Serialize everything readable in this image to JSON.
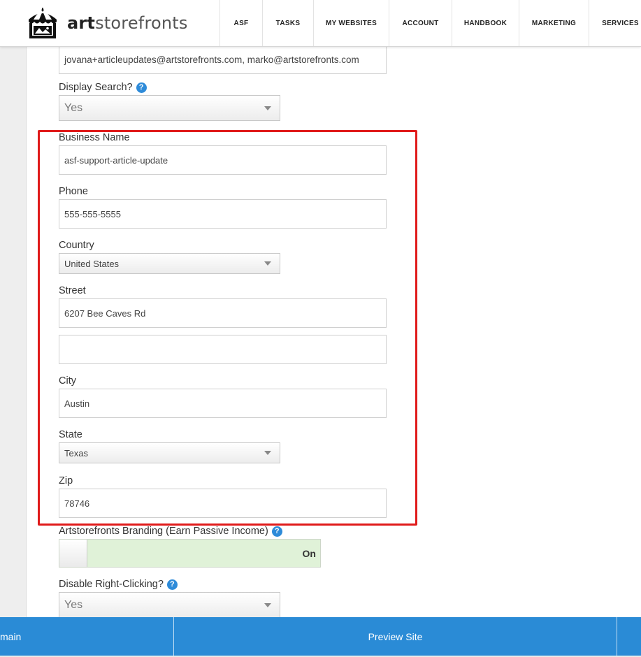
{
  "brand": {
    "logo_bold": "art",
    "logo_rest": "storefronts"
  },
  "nav": [
    {
      "label": "ASF"
    },
    {
      "label": "TASKS"
    },
    {
      "label": "MY WEBSITES"
    },
    {
      "label": "ACCOUNT"
    },
    {
      "label": "HANDBOOK"
    },
    {
      "label": "MARKETING"
    },
    {
      "label": "SERVICES"
    }
  ],
  "form": {
    "email_value": "jovana+articleupdates@artstorefronts.com, marko@artstorefronts.com",
    "display_search": {
      "label": "Display Search?",
      "value": "Yes"
    },
    "business_name": {
      "label": "Business Name",
      "value": "asf-support-article-update"
    },
    "phone": {
      "label": "Phone",
      "value": "555-555-5555"
    },
    "country": {
      "label": "Country",
      "value": "United States"
    },
    "street": {
      "label": "Street",
      "value": "6207 Bee Caves Rd",
      "value2": ""
    },
    "city": {
      "label": "City",
      "value": "Austin"
    },
    "state": {
      "label": "State",
      "value": "Texas"
    },
    "zip": {
      "label": "Zip",
      "value": "78746"
    },
    "branding": {
      "label": "Artstorefronts Branding (Earn Passive Income)",
      "state": "On"
    },
    "disable_right_click": {
      "label": "Disable Right-Clicking?",
      "value": "Yes"
    }
  },
  "footer": {
    "left_label": "main",
    "preview_label": "Preview Site"
  },
  "colors": {
    "accent": "#2a8bd6",
    "highlight": "#e01b1b",
    "toggle_on": "#e0f2d8"
  },
  "icons": {
    "help": "question-circle-icon",
    "logo": "storefront-tent-icon"
  }
}
